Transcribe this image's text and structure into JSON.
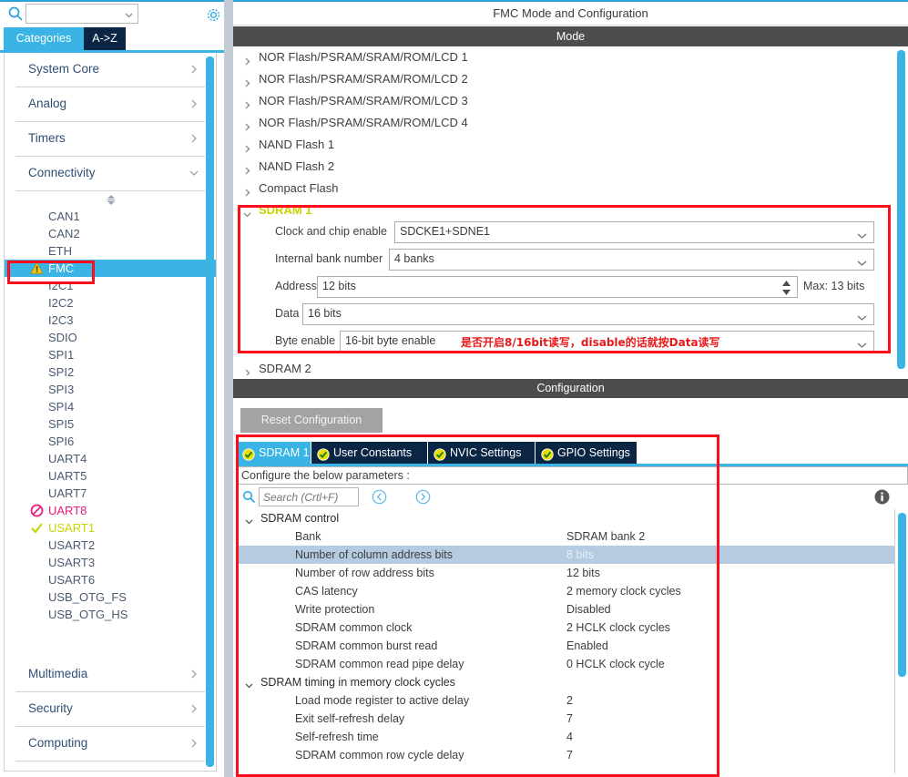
{
  "left_panel": {
    "search": {
      "value": "",
      "placeholder": "",
      "icon": "search-icon"
    },
    "gear_icon": "gear-icon",
    "tabs": [
      {
        "label": "Categories",
        "active": true
      },
      {
        "label": "A->Z",
        "active": false
      }
    ],
    "categories": [
      {
        "label": "System Core",
        "expanded": false
      },
      {
        "label": "Analog",
        "expanded": false
      },
      {
        "label": "Timers",
        "expanded": false
      },
      {
        "label": "Connectivity",
        "expanded": true
      }
    ],
    "connectivity_items": [
      {
        "label": "CAN1",
        "status": "none"
      },
      {
        "label": "CAN2",
        "status": "none"
      },
      {
        "label": "ETH",
        "status": "none"
      },
      {
        "label": "FMC",
        "status": "warning",
        "selected": true
      },
      {
        "label": "I2C1",
        "status": "none"
      },
      {
        "label": "I2C2",
        "status": "none"
      },
      {
        "label": "I2C3",
        "status": "none"
      },
      {
        "label": "SDIO",
        "status": "none"
      },
      {
        "label": "SPI1",
        "status": "none"
      },
      {
        "label": "SPI2",
        "status": "none"
      },
      {
        "label": "SPI3",
        "status": "none"
      },
      {
        "label": "SPI4",
        "status": "none"
      },
      {
        "label": "SPI5",
        "status": "none"
      },
      {
        "label": "SPI6",
        "status": "none"
      },
      {
        "label": "UART4",
        "status": "none"
      },
      {
        "label": "UART5",
        "status": "none"
      },
      {
        "label": "UART7",
        "status": "none"
      },
      {
        "label": "UART8",
        "status": "disabled"
      },
      {
        "label": "USART1",
        "status": "ok"
      },
      {
        "label": "USART2",
        "status": "none"
      },
      {
        "label": "USART3",
        "status": "none"
      },
      {
        "label": "USART6",
        "status": "none"
      },
      {
        "label": "USB_OTG_FS",
        "status": "none"
      },
      {
        "label": "USB_OTG_HS",
        "status": "none"
      }
    ],
    "bottom_categories": [
      {
        "label": "Multimedia",
        "expanded": false
      },
      {
        "label": "Security",
        "expanded": false
      },
      {
        "label": "Computing",
        "expanded": false
      }
    ]
  },
  "right_panel": {
    "title": "FMC Mode and Configuration",
    "mode": {
      "header": "Mode",
      "collapsed_rows": [
        "NOR Flash/PSRAM/SRAM/ROM/LCD 1",
        "NOR Flash/PSRAM/SRAM/ROM/LCD 2",
        "NOR Flash/PSRAM/SRAM/ROM/LCD 3",
        "NOR Flash/PSRAM/SRAM/ROM/LCD 4",
        "NAND Flash 1",
        "NAND Flash 2",
        "Compact Flash"
      ],
      "sdram1": {
        "title": "SDRAM 1",
        "expanded": true,
        "fields": [
          {
            "label": "Clock and chip enable",
            "value": "SDCKE1+SDNE1",
            "type": "combo"
          },
          {
            "label": "Internal bank number",
            "value": "4 banks",
            "type": "combo"
          },
          {
            "label": "Address",
            "value": "12 bits",
            "type": "spinner",
            "note": "Max: 13 bits"
          },
          {
            "label": "Data",
            "value": "16 bits",
            "type": "combo"
          },
          {
            "label": "Byte enable",
            "value": "16-bit byte enable",
            "type": "combo",
            "annotation": "是否开启8/16bit读写，disable的话就按Data读写"
          }
        ]
      },
      "sdram2": {
        "title": "SDRAM 2",
        "expanded": false
      }
    },
    "configuration": {
      "header": "Configuration",
      "reset_button": "Reset Configuration",
      "tabs": [
        {
          "label": "SDRAM 1",
          "active": true
        },
        {
          "label": "User Constants",
          "active": false
        },
        {
          "label": "NVIC Settings",
          "active": false
        },
        {
          "label": "GPIO Settings",
          "active": false
        }
      ],
      "prompt": "Configure the below parameters :",
      "search": {
        "value": "",
        "placeholder": "Search (Crtl+F)"
      },
      "prev_icon": "chevron-left-circle-icon",
      "next_icon": "chevron-right-circle-icon",
      "info_icon": "info-icon",
      "groups": [
        {
          "title": "SDRAM control",
          "expanded": true,
          "rows": [
            {
              "name": "Bank",
              "value": "SDRAM bank 2",
              "selected": false
            },
            {
              "name": "Number of column address bits",
              "value": "8 bits",
              "selected": true
            },
            {
              "name": "Number of row address bits",
              "value": "12 bits",
              "selected": false
            },
            {
              "name": "CAS latency",
              "value": "2 memory clock cycles",
              "selected": false
            },
            {
              "name": "Write protection",
              "value": "Disabled",
              "selected": false
            },
            {
              "name": "SDRAM common clock",
              "value": "2 HCLK clock cycles",
              "selected": false
            },
            {
              "name": "SDRAM common burst read",
              "value": "Enabled",
              "selected": false
            },
            {
              "name": "SDRAM common read pipe delay",
              "value": "0 HCLK clock cycle",
              "selected": false
            }
          ]
        },
        {
          "title": "SDRAM timing in memory clock cycles",
          "expanded": true,
          "rows": [
            {
              "name": "Load mode register to active delay",
              "value": "2",
              "selected": false
            },
            {
              "name": "Exit self-refresh delay",
              "value": "7",
              "selected": false
            },
            {
              "name": "Self-refresh time",
              "value": "4",
              "selected": false
            },
            {
              "name": "SDRAM common row cycle delay",
              "value": "7",
              "selected": false
            }
          ]
        }
      ]
    }
  },
  "annotations": {
    "boxes": [
      "fmc-sidebar-item",
      "sdram1-mode-section",
      "sdram1-config-section"
    ],
    "color": "#fb0d1b"
  },
  "colors": {
    "accent_blue": "#3ab3e5",
    "tab_navy": "#0b2545",
    "header_gray": "#4d4d4d",
    "selection_row": "#b4cbe2",
    "sdram_title_yellow": "#c8d400",
    "warning_yellow": "#f5c518",
    "disabled_pink": "#e8197d",
    "annotation_red": "#fb0d1b"
  }
}
